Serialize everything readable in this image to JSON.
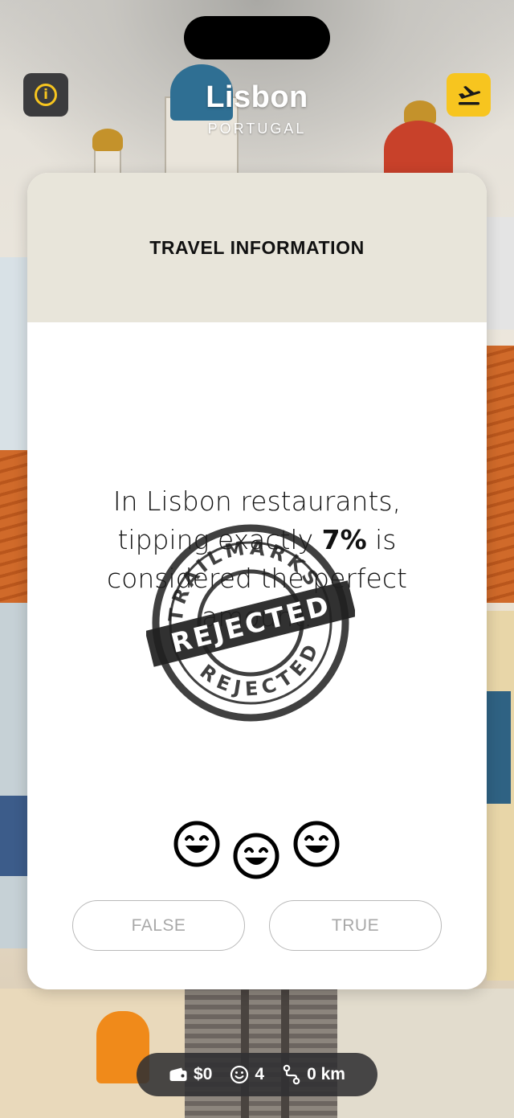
{
  "header": {
    "city": "Lisbon",
    "country": "PORTUGAL",
    "info_icon": "info-icon",
    "depart_icon": "airplane-departure-icon"
  },
  "card": {
    "title": "TRAVEL INFORMATION",
    "statement_before": "In Lisbon restaurants, tipping exactly ",
    "statement_highlight": "7%",
    "statement_after": " is considered the perfect amount.",
    "stamp": {
      "ring_text": "TRAILMARKS",
      "center_text": "REJECTED",
      "bottom_text": "REJECTED"
    },
    "reaction_icons": [
      "grinning-face-icon",
      "grinning-face-icon",
      "grinning-face-icon"
    ],
    "buttons": {
      "false_label": "FALSE",
      "true_label": "TRUE"
    }
  },
  "stats": {
    "money": "$0",
    "happiness": "4",
    "distance": "0 km",
    "icons": [
      "wallet-icon",
      "smiley-icon",
      "route-icon"
    ]
  },
  "colors": {
    "accent": "#f7c51f",
    "card_header_bg": "#e8e5da",
    "dark_button": "#3b3b3d"
  }
}
